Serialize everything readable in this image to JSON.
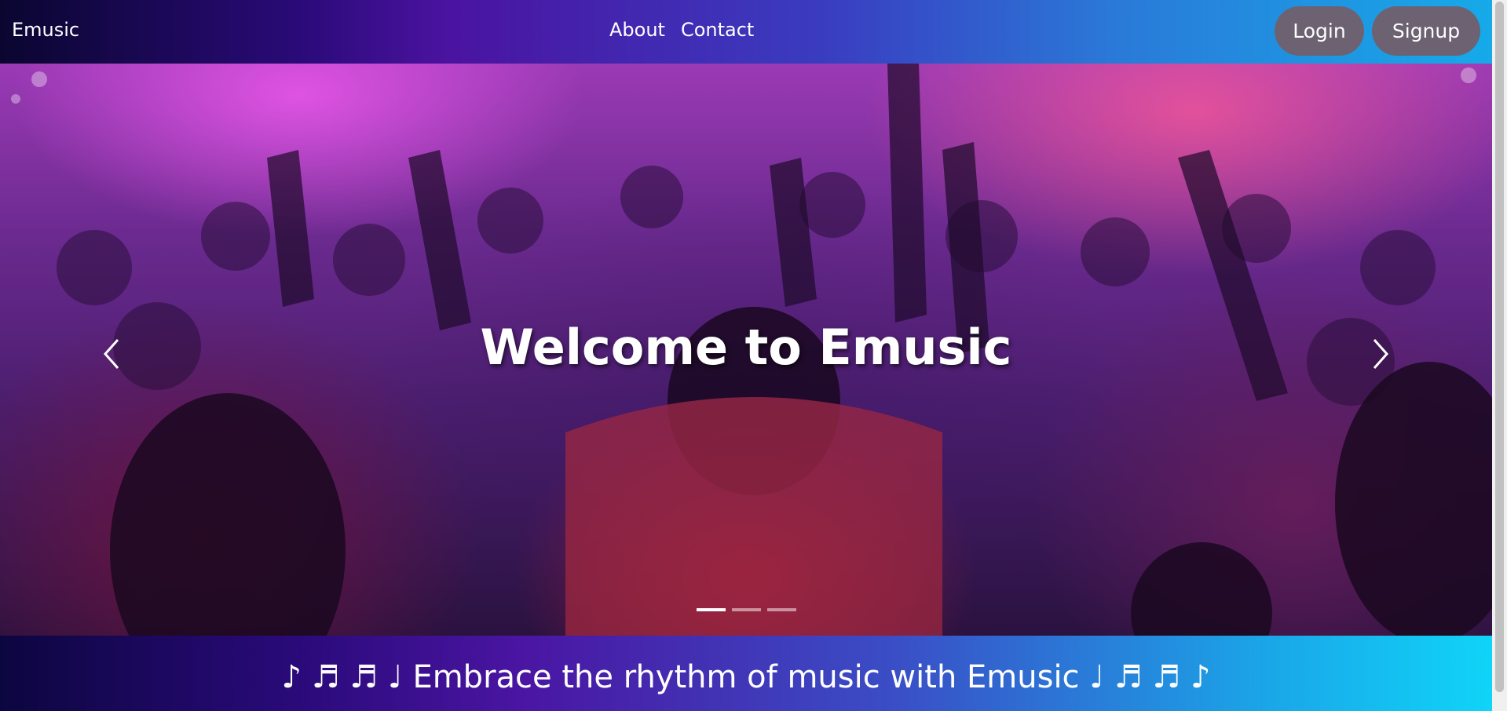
{
  "navbar": {
    "brand": "Emusic",
    "links": [
      "About",
      "Contact"
    ],
    "login_label": "Login",
    "signup_label": "Signup"
  },
  "hero": {
    "title": "Welcome to Emusic",
    "slide_count": 3,
    "active_slide": 1
  },
  "tagline": "♪ ♬ ♬ ♩ Embrace the rhythm of music with Emusic ♩ ♬ ♬ ♪",
  "colors": {
    "navbar_start": "#0a0630",
    "navbar_end": "#16aaea",
    "button_bg": "#6d6272",
    "tagline_end": "#10d4f8"
  }
}
